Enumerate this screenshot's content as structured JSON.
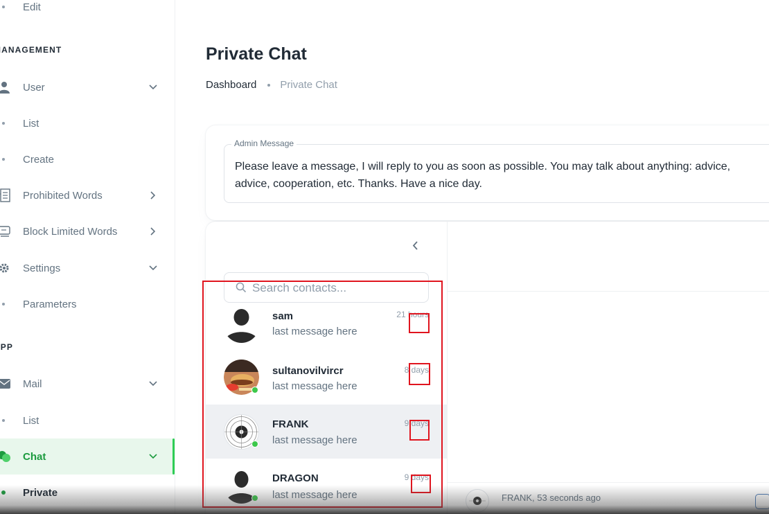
{
  "sidebar": {
    "items": [
      {
        "label": "Edit"
      },
      {
        "label": "List"
      },
      {
        "label": "Create"
      },
      {
        "label": "Prohibited Words"
      },
      {
        "label": "Block Limited Words"
      },
      {
        "label": "Settings"
      },
      {
        "label": "Parameters"
      },
      {
        "label": "Mail"
      },
      {
        "label": "List"
      },
      {
        "label": "Chat"
      },
      {
        "label": "Private"
      },
      {
        "label": "User"
      }
    ],
    "sections": {
      "management": "MANAGEMENT",
      "app": "APP"
    }
  },
  "main": {
    "title": "Private Chat",
    "breadcrumb": [
      "Dashboard",
      "Private Chat"
    ],
    "admin_message": {
      "legend": "Admin Message",
      "text": "Please leave a message, I will reply to you as soon as possible. You may talk about anything: advice,\nadvice, cooperation, etc. Thanks. Have a nice day."
    },
    "search": {
      "placeholder": "Search contacts..."
    },
    "contacts": [
      {
        "name": "sam",
        "message": "last message here",
        "time": "21 hours",
        "online": false
      },
      {
        "name": "sultanovilvircr",
        "message": "last message here",
        "time": "8 days",
        "online": true
      },
      {
        "name": "FRANK",
        "message": "last message here",
        "time": "9 days",
        "online": true,
        "selected": true
      },
      {
        "name": "DRAGON",
        "message": "last message here",
        "time": "9 days",
        "online": true
      }
    ],
    "conversation_footer": {
      "text": "FRANK, 53 seconds ago"
    }
  },
  "colors": {
    "accent": "#1c9b3f",
    "online": "#3cc84b",
    "annotation": "#e0141e"
  },
  "icons": [
    "user-icon",
    "chevron-down-icon",
    "prohibited-words-icon",
    "chevron-right-icon",
    "block-limited-words-icon",
    "gear-icon",
    "mail-icon",
    "chat-icon",
    "chevron-left-icon",
    "search-icon"
  ]
}
